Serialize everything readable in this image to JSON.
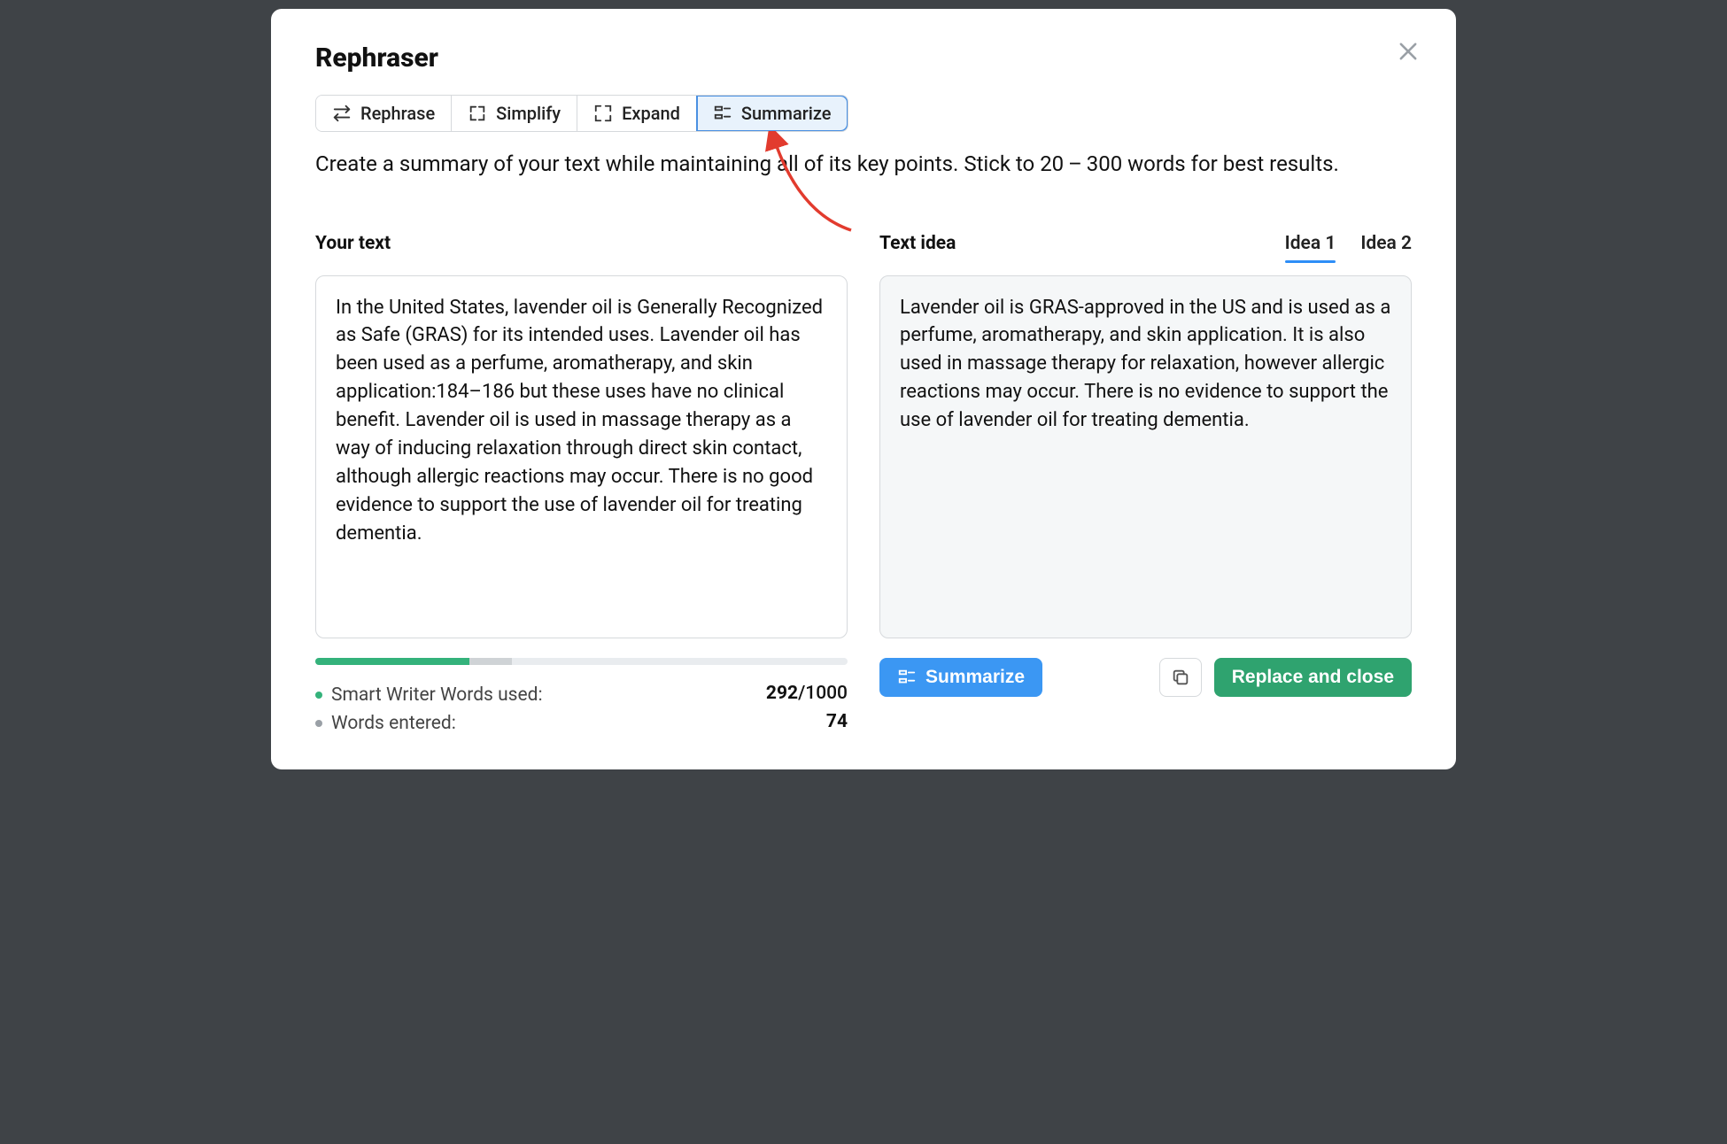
{
  "title": "Rephraser",
  "modes": {
    "rephrase": "Rephrase",
    "simplify": "Simplify",
    "expand": "Expand",
    "summarize": "Summarize"
  },
  "active_mode": "summarize",
  "hint": "Create a summary of your text while maintaining all of its key points. Stick to 20 – 300 words for best results.",
  "left": {
    "label": "Your text",
    "text": "In the United States, lavender oil is Generally Recognized as Safe (GRAS) for its intended uses. Lavender oil has been used as a perfume, aromatherapy, and skin application:184–186 but these uses have no clinical benefit. Lavender oil is used in massage therapy as a way of inducing relaxation through direct skin contact, although allergic reactions may occur. There is no good evidence to support the use of lavender oil for treating dementia."
  },
  "right": {
    "label": "Text idea",
    "idea_tabs": [
      "Idea 1",
      "Idea 2"
    ],
    "active_idea": 0,
    "text": "Lavender oil is GRAS-approved in the US and is used as a perfume, aromatherapy, and skin application. It is also used in massage therapy for relaxation, however allergic reactions may occur. There is no evidence to support the use of lavender oil for treating dementia."
  },
  "stats": {
    "smart_writer_label": "Smart Writer Words used:",
    "smart_writer_used": "292",
    "smart_writer_total": "/1000",
    "words_entered_label": "Words entered:",
    "words_entered": "74",
    "progress_fill_pct": 29,
    "progress_mid_pct": 8
  },
  "buttons": {
    "summarize": "Summarize",
    "replace_close": "Replace and close"
  }
}
